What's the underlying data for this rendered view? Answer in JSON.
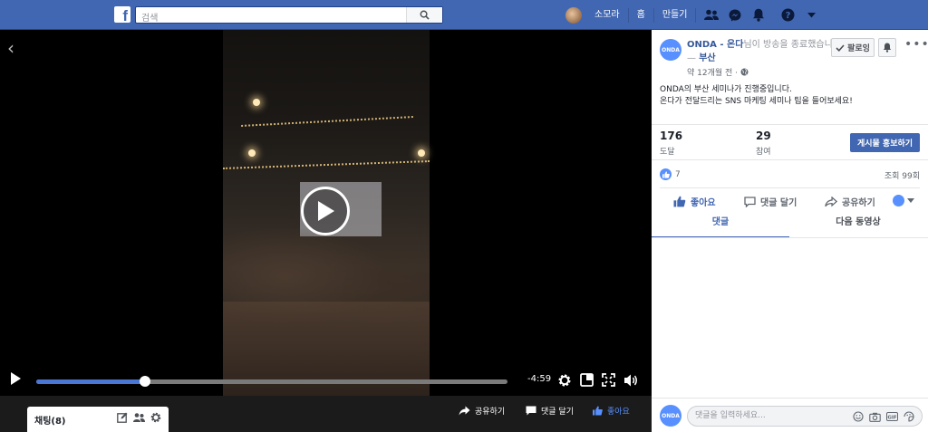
{
  "topbar": {
    "logo": "f",
    "search_placeholder": "검색",
    "profile_name": "소모라",
    "home_label": "홈",
    "create_label": "만들기"
  },
  "video": {
    "time_remaining": "-4:59",
    "progress_fraction": 0.23
  },
  "bottom_bar": {
    "chat_label": "채팅(8)",
    "share_label": "공유하기",
    "comment_label": "댓글 달기",
    "like_label": "좋아요"
  },
  "panel": {
    "page_avatar_text": "ONDA",
    "page_name": "ONDA - 온다",
    "title_mid": "님이 방송을 종료했습니다 — ",
    "location": "부산",
    "meta": "약 12개월 전 · ",
    "follow_label": "팔로잉",
    "more_label": "•••",
    "body_line1": "ONDA의 부산 세미나가 진행중입니다.",
    "body_line2": "온다가 전달드리는 SNS 마케팅 세미나 팁을 들어보세요!",
    "reach_num": "176",
    "reach_label": "도달",
    "engage_num": "29",
    "engage_label": "참여",
    "boost_label": "게시물 홍보하기",
    "like_count": "7",
    "views": "조회 99회",
    "act_like": "좋아요",
    "act_comment": "댓글 달기",
    "act_share": "공유하기",
    "tab_comments": "댓글",
    "tab_next": "다음 동영상",
    "comment_placeholder": "댓글을 입력하세요..."
  },
  "colors": {
    "brand": "#4267b2",
    "progress": "#4a76d4"
  }
}
